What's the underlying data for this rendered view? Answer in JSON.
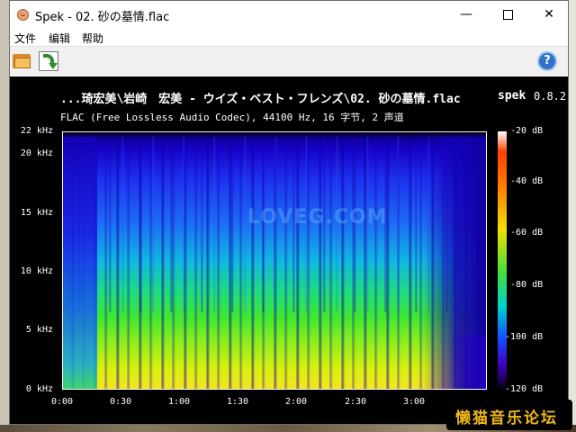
{
  "window": {
    "title": "Spek - 02. 砂の墓情.flac",
    "min_label": "—",
    "close_label": "✕"
  },
  "menu": {
    "items": [
      {
        "label": "文件"
      },
      {
        "label": "编辑"
      },
      {
        "label": "帮助"
      }
    ]
  },
  "toolbar": {
    "open_icon": "folder-open-icon",
    "settings_icon": "settings-icon",
    "help_icon": "help-icon",
    "help_glyph": "?"
  },
  "spectrogram": {
    "path_title": "...琦宏美\\岩崎　宏美 - ウイズ・ベスト・フレンズ\\02. 砂の墓情.flac",
    "app_name": "spek",
    "app_version": "0.8.2",
    "file_info": "FLAC (Free Lossless Audio Codec), 44100 Hz, 16 字节, 2 声道",
    "y_labels": [
      "22 kHz",
      "20 kHz",
      "15 kHz",
      "10 kHz",
      "5 kHz",
      "0 kHz"
    ],
    "x_labels": [
      "0:00",
      "0:30",
      "1:00",
      "1:30",
      "2:00",
      "2:30",
      "3:00"
    ],
    "db_labels": [
      "-20 dB",
      "-40 dB",
      "-60 dB",
      "-80 dB",
      "-100 dB",
      "-120 dB"
    ],
    "watermark": "LOVEG.COM"
  },
  "forum": {
    "logo_text": "懒猫音乐论坛"
  },
  "colors": {
    "accent": "#2f72c8",
    "background": "#000000"
  }
}
